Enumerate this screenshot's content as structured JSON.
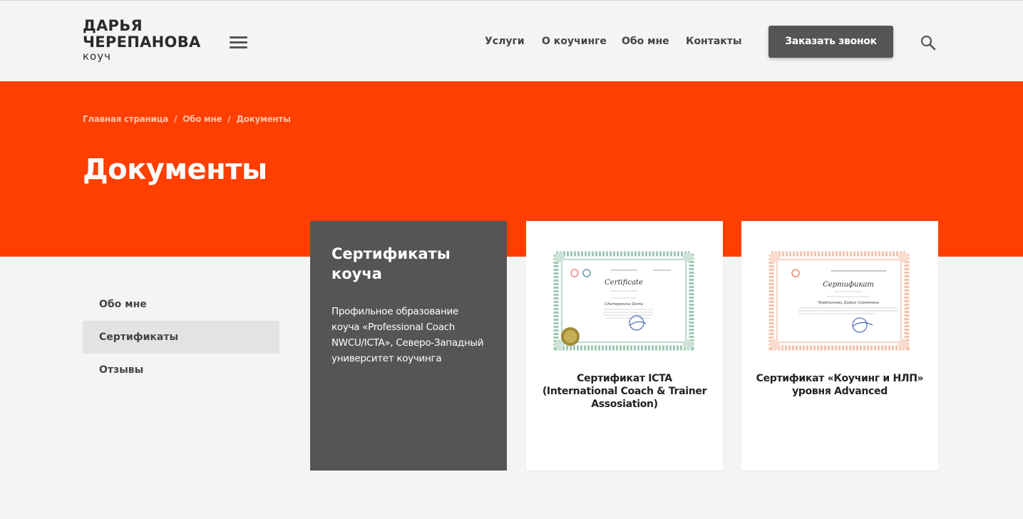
{
  "header": {
    "logo": {
      "line1": "ДАРЬЯ",
      "line2": "ЧЕРЕПАНОВА",
      "line3": "коуч"
    },
    "nav": [
      {
        "label": "Услуги"
      },
      {
        "label": "О коучинге"
      },
      {
        "label": "Обо мне"
      },
      {
        "label": "Контакты"
      }
    ],
    "cta_label": "Заказать звонок",
    "icons": {
      "menu": "hamburger-menu-icon",
      "search": "search-icon"
    }
  },
  "breadcrumb": [
    "Главная страница",
    "Обо мне",
    "Документы"
  ],
  "breadcrumb_separator": "/",
  "page_title": "Документы",
  "sidebar": {
    "items": [
      {
        "label": "Обо мне",
        "active": false
      },
      {
        "label": "Сертификаты",
        "active": true
      },
      {
        "label": "Отзывы",
        "active": false
      }
    ]
  },
  "intro_card": {
    "title": "Сертификаты коуча",
    "text": "Профильное образование коуча «Professional Coach NWCU/ICTA», Северо-Западный университет коучинга"
  },
  "certificates": [
    {
      "caption": "Сертификат ICTA (International Coach & Trainer Assosiation)",
      "thumb": {
        "heading": "Certificate",
        "name": "Cherepanova Daria",
        "frame_color": "#9fc8b4",
        "seal_color": "#a08a3a"
      }
    },
    {
      "caption": "Сертификат «Коучинг и НЛП» уровня Advanced",
      "thumb": {
        "heading": "Сертификат",
        "name": "Черепанова Дарья Сергеевна",
        "frame_color": "#f4c3ae",
        "seal_color": ""
      }
    }
  ],
  "colors": {
    "accent": "#ff3f00",
    "dark_card": "#555555",
    "background": "#f4f4f4"
  }
}
